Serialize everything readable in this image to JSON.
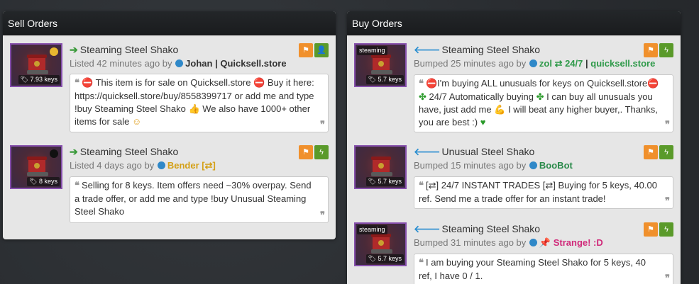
{
  "sell": {
    "header": "Sell Orders",
    "listings": [
      {
        "title": "Steaming Steel Shako",
        "meta_prefix": "Listed 42 minutes ago by",
        "user": "Johan",
        "user_suffix": "Quicksell.store",
        "price": "7.93 keys",
        "dot_color": "#e8b830",
        "comment_parts": [
          "This item is for sale on Quicksell.store",
          "Buy it here: https://quicksell.store/buy/8558399717 or add me and type !buy Steaming Steel Shako",
          "We also have 1000+ other items for sale"
        ]
      },
      {
        "title": "Steaming Steel Shako",
        "meta_prefix": "Listed 4 days ago by",
        "user": "Bender [⇄]",
        "price": "8 keys",
        "dot_color": "#111111",
        "comment": "Selling for 8 keys. Item offers need ~30% overpay. Send a trade offer, or add me and type !buy Unusual Steaming Steel Shako"
      }
    ]
  },
  "buy": {
    "header": "Buy Orders",
    "listings": [
      {
        "title": "Steaming Steel Shako",
        "quality": "steaming",
        "meta_prefix": "Bumped 25 minutes ago by",
        "user": "zol ⇄ 24/7",
        "user_suffix": "quicksell.store",
        "price": "5.7 keys",
        "comment_parts": [
          "I'm buying ALL unusuals for keys on Quicksell.store",
          "24/7 Automatically buying",
          "I can buy all unusuals you have, just add me",
          "I will beat any higher buyer,. Thanks, you are best :)"
        ]
      },
      {
        "title": "Unusual Steel Shako",
        "meta_prefix": "Bumped 15 minutes ago by",
        "user": "BooBot",
        "price": "5.7 keys",
        "comment": "[⇄] 24/7 INSTANT TRADES [⇄] Buying for 5 keys, 40.00 ref. Send me a trade offer for an instant trade!"
      },
      {
        "title": "Steaming Steel Shako",
        "quality": "steaming",
        "meta_prefix": "Bumped 31 minutes ago by",
        "user": "Strange! :D",
        "price": "5.7 keys",
        "comment": "I am buying your Steaming Steel Shako for 5 keys, 40 ref, I have 0 / 1."
      }
    ]
  },
  "icons": {
    "flag": "flag-icon",
    "add_friend": "add-friend-icon",
    "lightning": "lightning-icon",
    "quote": "quote-icon"
  },
  "colors": {
    "unusual_border": "#8650ac",
    "flag_button": "#f0902c",
    "action_button": "#5a9a2a",
    "online_dot": "#2f88c8"
  }
}
